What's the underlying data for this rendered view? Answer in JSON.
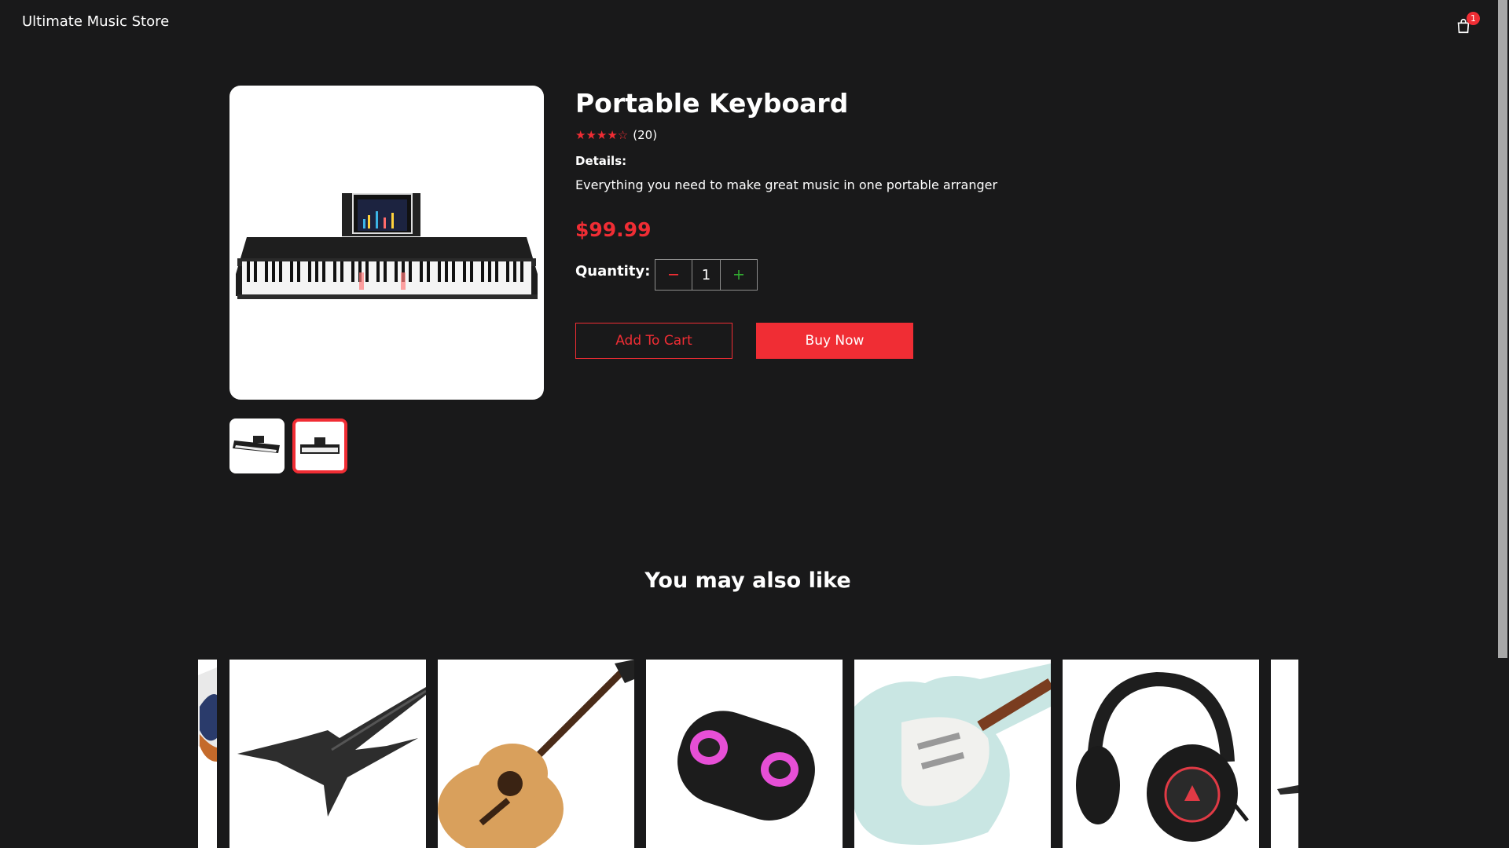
{
  "navbar": {
    "brand": "Ultimate Music Store",
    "cart_icon": "shopping-bag-icon",
    "cart_count": "1"
  },
  "product": {
    "name": "Portable Keyboard",
    "rating": 4,
    "rating_max": 5,
    "review_count": "(20)",
    "details_label": "Details:",
    "details": "Everything you need to make great music in one portable arranger",
    "price": "$99.99",
    "quantity_label": "Quantity:",
    "quantity": "1",
    "minus_icon": "minus-icon",
    "plus_icon": "plus-icon",
    "add_to_cart": "Add To Cart",
    "buy_now": "Buy Now",
    "selected_thumbnail": 1
  },
  "recommendations": {
    "heading": "You may also like",
    "items": [
      "electric-guitar-image",
      "explorer-guitar-image",
      "acoustic-guitar-image",
      "bluetooth-speaker-image",
      "stratocaster-guitar-image",
      "gaming-headphones-image",
      "guitar-image"
    ]
  },
  "colors": {
    "background": "#19191a",
    "accent": "#f02d34",
    "plus": "#31a831"
  }
}
